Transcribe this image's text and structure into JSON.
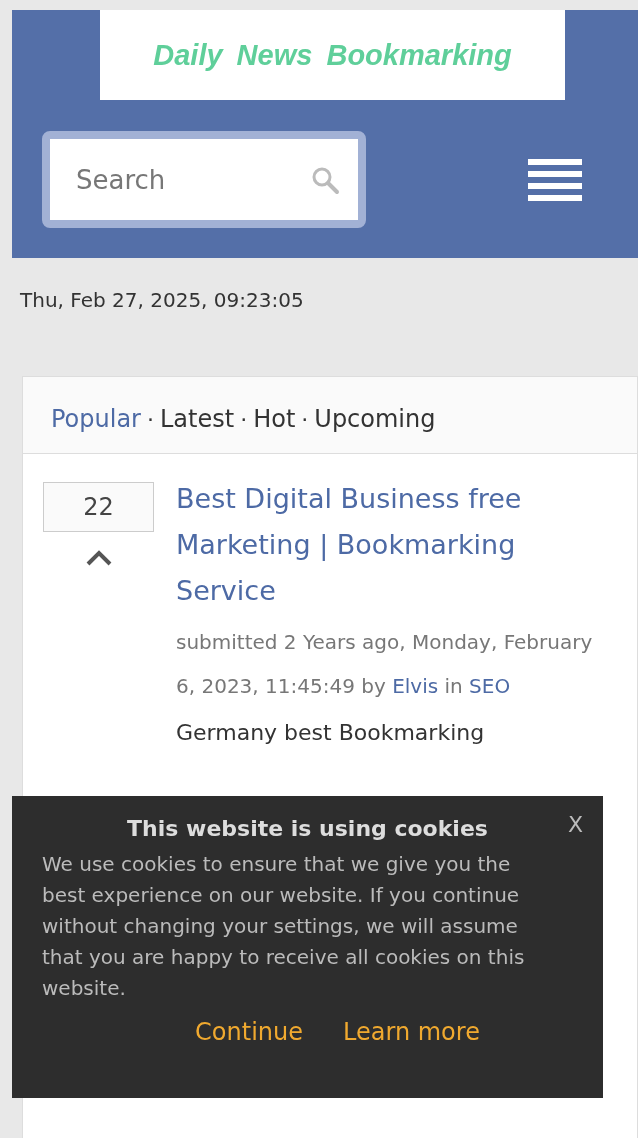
{
  "header": {
    "logo": "Daily News Bookmarking",
    "search": {
      "placeholder": "Search"
    }
  },
  "datetime": "Thu, Feb 27, 2025, 09:23:05",
  "tabs": [
    {
      "label": "Popular",
      "selected": true,
      "separator": "·"
    },
    {
      "label": "Latest",
      "selected": false,
      "separator": "·"
    },
    {
      "label": "Hot",
      "selected": false,
      "separator": "·"
    },
    {
      "label": "Upcoming",
      "selected": false
    }
  ],
  "post": {
    "votes": "22",
    "title": "Best Digital Business free Marketing | Bookmarking Service",
    "submitted": "submitted 2 Years ago, Monday, February 6, 2023, 11:45:49 by",
    "author": "Elvis",
    "in_word": "in",
    "category": "SEO",
    "description": "Germany best Bookmarking"
  },
  "cookie_banner": {
    "title": "This website is using cookies",
    "close": "X",
    "text": "We use cookies to ensure that we give you the best experience on our website. If you continue without changing your settings, we will assume that you are happy to receive all cookies on this website.",
    "buttons": [
      "Continue",
      "Learn more"
    ]
  }
}
